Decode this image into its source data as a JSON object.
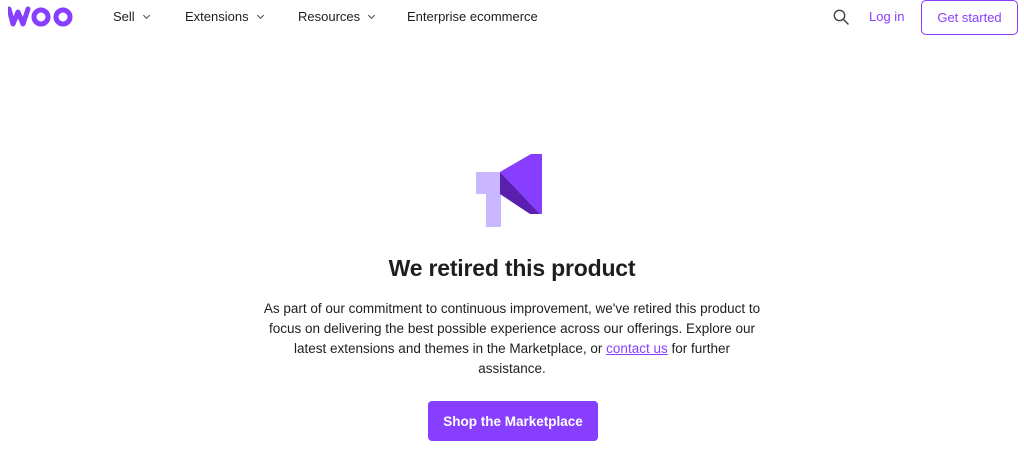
{
  "header": {
    "logo_text": "woo",
    "nav": [
      {
        "label": "Sell",
        "has_dropdown": true
      },
      {
        "label": "Extensions",
        "has_dropdown": true
      },
      {
        "label": "Resources",
        "has_dropdown": true
      },
      {
        "label": "Enterprise ecommerce",
        "has_dropdown": false
      }
    ],
    "search_icon": "search-icon",
    "login_label": "Log in",
    "get_started_label": "Get started"
  },
  "main": {
    "icon": "megaphone-icon",
    "title": "We retired this product",
    "description_before": "As part of our commitment to continuous improvement, we've retired this product to focus on delivering the best possible experience across our offerings. Explore our latest extensions and themes in the Marketplace, or ",
    "contact_link": "contact us",
    "description_after": " for further assistance.",
    "cta_label": "Shop the Marketplace"
  },
  "colors": {
    "brand": "#873eff",
    "brand_dark": "#5b1fb0",
    "brand_light": "#c9b8ff",
    "text": "#1e1e1e"
  }
}
